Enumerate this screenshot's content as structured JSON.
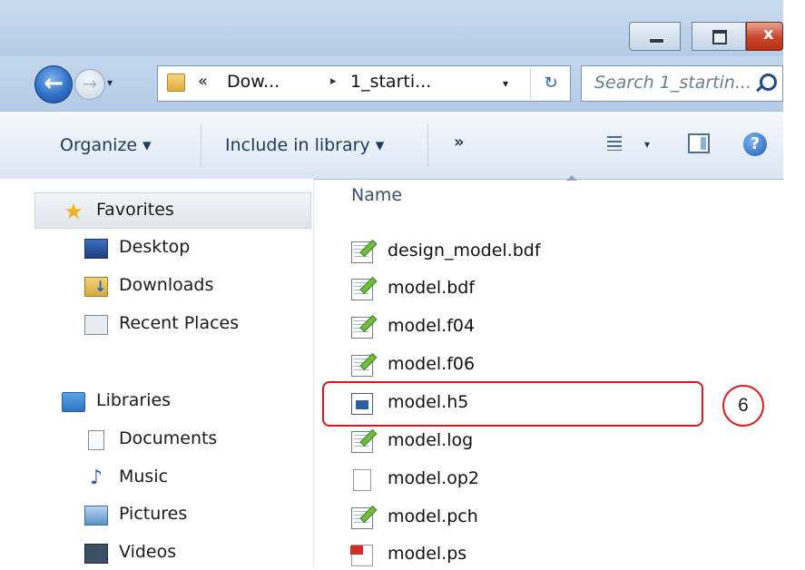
{
  "window": {
    "caption_buttons": [
      "minimize",
      "maximize",
      "close"
    ],
    "close_glyph": "x",
    "accent": "#c8452c"
  },
  "address": {
    "chevron": "«",
    "crumbs": [
      "Dow...",
      "1_starti..."
    ],
    "separator": "▸",
    "dropdown_glyph": "▾",
    "refresh_glyph": "↻"
  },
  "search": {
    "placeholder": "Search 1_startin..."
  },
  "toolbar": {
    "organize_label": "Organize ▾",
    "include_label": "Include in library ▾",
    "more_label": "»",
    "views_dropdown": "▾",
    "help_label": "?"
  },
  "sidebar": {
    "favorites": {
      "label": "Favorites",
      "items": [
        {
          "label": "Desktop",
          "icon": "desktop-icon"
        },
        {
          "label": "Downloads",
          "icon": "downloads-icon"
        },
        {
          "label": "Recent Places",
          "icon": "recent-places-icon"
        }
      ]
    },
    "libraries": {
      "label": "Libraries",
      "items": [
        {
          "label": "Documents",
          "icon": "documents-icon"
        },
        {
          "label": "Music",
          "icon": "music-icon"
        },
        {
          "label": "Pictures",
          "icon": "pictures-icon"
        },
        {
          "label": "Videos",
          "icon": "videos-icon"
        }
      ]
    }
  },
  "files": {
    "column_name": "Name",
    "items": [
      {
        "name": "design_model.bdf",
        "icon": "notepad-file-icon"
      },
      {
        "name": "model.bdf",
        "icon": "notepad-file-icon"
      },
      {
        "name": "model.f04",
        "icon": "notepad-file-icon"
      },
      {
        "name": "model.f06",
        "icon": "notepad-file-icon"
      },
      {
        "name": "model.h5",
        "icon": "h5-file-icon"
      },
      {
        "name": "model.log",
        "icon": "notepad-file-icon"
      },
      {
        "name": "model.op2",
        "icon": "blank-file-icon"
      },
      {
        "name": "model.pch",
        "icon": "notepad-file-icon"
      },
      {
        "name": "model.ps",
        "icon": "ps-file-icon"
      }
    ]
  },
  "annotation": {
    "callout_number": "6",
    "highlight_color": "#e0141a"
  }
}
